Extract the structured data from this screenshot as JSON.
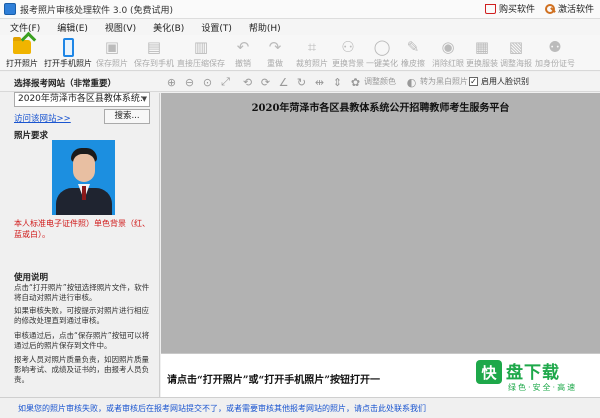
{
  "window": {
    "title": "报考照片审核处理软件 3.0 (免费试用)",
    "buy_label": "购买软件",
    "activate_label": "激活软件"
  },
  "menu": [
    "文件(F)",
    "编辑(E)",
    "视图(V)",
    "美化(B)",
    "设置(T)",
    "帮助(H)"
  ],
  "toolbar": {
    "open_photo": "打开照片",
    "open_phone_photo": "打开手机照片",
    "save_photo": "保存照片",
    "save_to_phone": "保存到手机",
    "direct_compress_save": "直接压缩保存",
    "undo": "撤销",
    "redo": "重做",
    "crop_photo": "裁剪照片",
    "replace_background": "更换背景",
    "one_key_beautify": "一键美化",
    "eraser": "橡皮擦",
    "remove_red_eye": "消除红眼",
    "change_clothes": "更换服装",
    "adjust_layout": "调整海报",
    "add_id_number": "加身份证号"
  },
  "toolbar2": {
    "adjust_color": "调整颜色",
    "to_black_white": "转为黑白照片",
    "enable_face_detect": "启用人脸识别",
    "enable_face_detect_checked": "✓"
  },
  "left": {
    "select_site_title": "选择报考网站（非常重要）",
    "site_value": "2020年菏泽市各区县教体系统:",
    "visit_link": "访问该网站>>",
    "search_button": "搜索...",
    "photo_req_title": "照片要求",
    "photo_req_note": "本人标准电子证件照）单色背景（红、蓝或白）。",
    "help_title": "使用说明",
    "help_1": "点击“打开照片”按钮选择照片文件，软件将自动对照片进行审核。",
    "help_2": "如果审核失败，可按提示对照片进行相应的修改处理直到通过审核。",
    "help_3": "审核通过后，点击“保存照片”按钮可以将通过后的照片保存到文件中。",
    "help_4": "报考人员对照片质量负责，如因照片质量影响考试、成绩及证书的，由报考人员负责。"
  },
  "canvas": {
    "title": "2020年菏泽市各区县教体系统公开招聘教师考生服务平台",
    "bottom_message": "请点击“打开照片”或“打开手机照片”按钮打开一"
  },
  "watermark": {
    "mark": "快",
    "name": "盘下载",
    "slogan": "绿色·安全·高速"
  },
  "status": {
    "text": "如果您的照片审核失败，或者审核后在报考网站提交不了，或者需要审核其他报考网站的照片，请点击此处联系我们"
  },
  "colors": {
    "link_blue": "#1a55d0",
    "warning_red": "#d01818",
    "photo_background_blue": "#1c8fe0",
    "watermark_green": "#1ea84a"
  }
}
